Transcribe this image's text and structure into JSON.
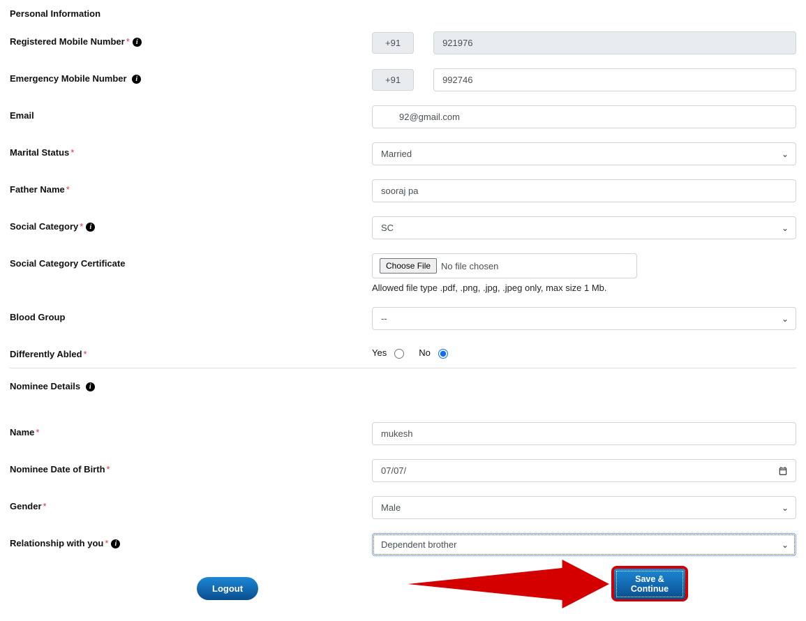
{
  "sections": {
    "personal_title": "Personal Information",
    "nominee_title": "Nominee Details"
  },
  "labels": {
    "registered_mobile": "Registered Mobile Number",
    "emergency_mobile": "Emergency Mobile Number",
    "email": "Email",
    "marital_status": "Marital Status",
    "father_name": "Father Name",
    "social_category": "Social Category",
    "social_cert": "Social Category Certificate",
    "blood_group": "Blood Group",
    "differently_abled": "Differently Abled",
    "nominee_name": "Name",
    "nominee_dob": "Nominee Date of Birth",
    "gender": "Gender",
    "relationship": "Relationship with you"
  },
  "values": {
    "country_code": "+91",
    "registered_mobile": "921976",
    "emergency_mobile": "992746",
    "email": "92@gmail.com",
    "marital_status": "Married",
    "father_name": "sooraj pa",
    "social_category": "SC",
    "blood_group": "--",
    "nominee_name": "mukesh",
    "nominee_dob": "07/07/",
    "gender": "Male",
    "relationship": "Dependent brother"
  },
  "radios": {
    "yes": "Yes",
    "no": "No"
  },
  "file": {
    "button": "Choose File",
    "placeholder": "No file chosen",
    "hint": "Allowed file type .pdf, .png, .jpg, .jpeg only, max size 1 Mb."
  },
  "buttons": {
    "logout": "Logout",
    "save": "Save & Continue"
  }
}
